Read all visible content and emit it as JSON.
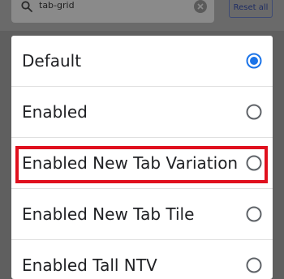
{
  "search": {
    "value": "tab-grid",
    "icon": "search-icon",
    "clear_icon": "clear-icon"
  },
  "toolbar": {
    "reset_label": "Reset all"
  },
  "dialog": {
    "options": [
      {
        "label": "Default",
        "selected": true
      },
      {
        "label": "Enabled",
        "selected": false
      },
      {
        "label": "Enabled New Tab Variation",
        "selected": false
      },
      {
        "label": "Enabled New Tab Tile",
        "selected": false
      },
      {
        "label": "Enabled Tall NTV",
        "selected": false
      }
    ]
  },
  "colors": {
    "accent": "#1a73e8",
    "highlight": "#e0101e"
  }
}
